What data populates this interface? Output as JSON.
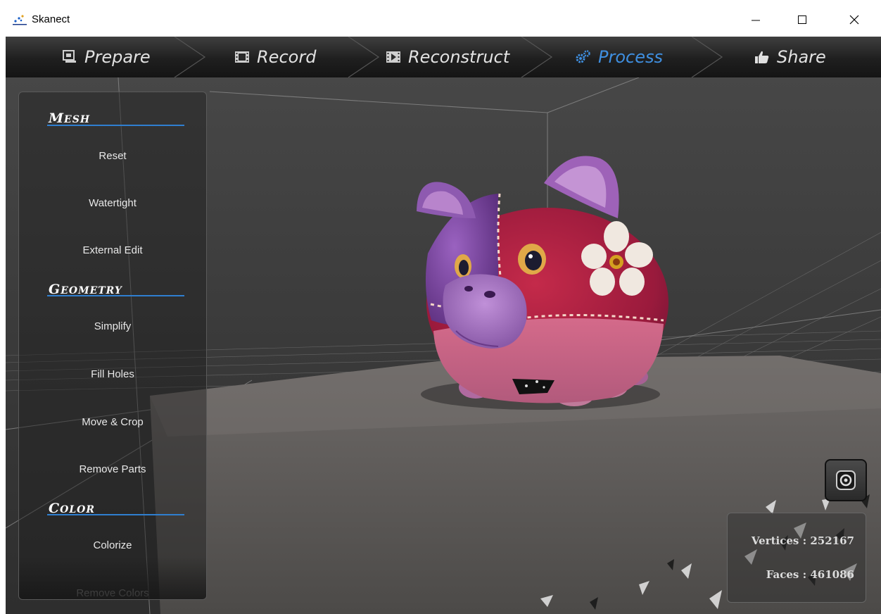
{
  "window": {
    "title": "Skanect",
    "controls": {
      "minimize": "minimize-icon",
      "maximize": "maximize-icon",
      "close": "close-icon"
    }
  },
  "nav": {
    "tabs": [
      {
        "label": "Prepare",
        "icon": "picture-frame-icon",
        "active": false
      },
      {
        "label": "Record",
        "icon": "film-icon",
        "active": false
      },
      {
        "label": "Reconstruct",
        "icon": "film-play-icon",
        "active": false
      },
      {
        "label": "Process",
        "icon": "gears-icon",
        "active": true
      },
      {
        "label": "Share",
        "icon": "thumbs-up-icon",
        "active": false
      }
    ],
    "active_color": "#3f8fe0",
    "text_color": "#e2e2e2"
  },
  "panel": {
    "sections": [
      {
        "title_cap": "M",
        "title_rest": "ESH",
        "items": [
          "Reset",
          "Watertight",
          "External Edit"
        ]
      },
      {
        "title_cap": "G",
        "title_rest": "EOMETRY",
        "items": [
          "Simplify",
          "Fill Holes",
          "Move & Crop",
          "Remove Parts"
        ]
      },
      {
        "title_cap": "C",
        "title_rest": "OLOR",
        "items": [
          "Colorize",
          "Remove Colors"
        ]
      }
    ],
    "accent": "#2f7fd0"
  },
  "stats": {
    "vertices_label": "Vertices :",
    "vertices_value": "252167",
    "faces_label": "Faces :",
    "faces_value": "461086"
  },
  "viewport": {
    "camera_button_icon": "camera-icon"
  }
}
